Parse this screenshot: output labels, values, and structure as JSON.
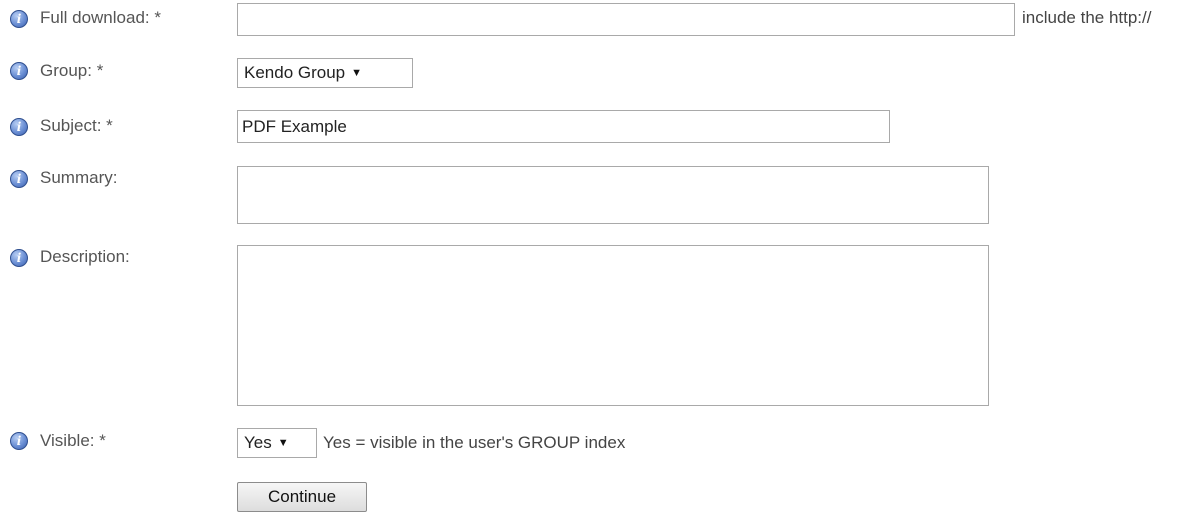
{
  "form": {
    "full_download": {
      "label": "Full download: *",
      "value": "",
      "hint": "include the http://"
    },
    "group": {
      "label": "Group: *",
      "selected": "Kendo Group"
    },
    "subject": {
      "label": "Subject: *",
      "value": "PDF Example"
    },
    "summary": {
      "label": "Summary:",
      "value": ""
    },
    "description": {
      "label": "Description:",
      "value": ""
    },
    "visible": {
      "label": "Visible: *",
      "selected": "Yes",
      "hint": "Yes = visible in the user's GROUP index"
    },
    "continue_label": "Continue"
  },
  "icons": {
    "info": "info-icon",
    "dropdown": "chevron-down-icon",
    "resize": "resize-grip-icon"
  }
}
